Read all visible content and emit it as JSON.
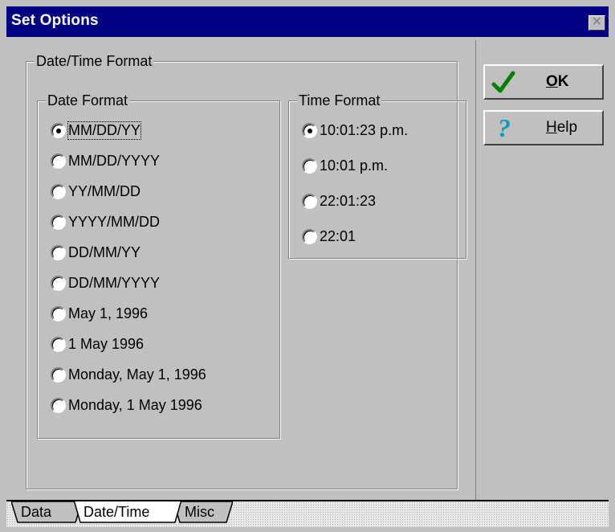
{
  "window": {
    "title": "Set Options",
    "close_glyph": "✕"
  },
  "panel": {
    "group_label": "Date/Time Format",
    "date_format": {
      "label": "Date Format",
      "options": [
        {
          "label": "MM/DD/YY",
          "checked": true
        },
        {
          "label": "MM/DD/YYYY",
          "checked": false
        },
        {
          "label": "YY/MM/DD",
          "checked": false
        },
        {
          "label": "YYYY/MM/DD",
          "checked": false
        },
        {
          "label": "DD/MM/YY",
          "checked": false
        },
        {
          "label": "DD/MM/YYYY",
          "checked": false
        },
        {
          "label": "May 1, 1996",
          "checked": false
        },
        {
          "label": "1 May 1996",
          "checked": false
        },
        {
          "label": "Monday, May 1, 1996",
          "checked": false
        },
        {
          "label": "Monday, 1 May 1996",
          "checked": false
        }
      ]
    },
    "time_format": {
      "label": "Time Format",
      "options": [
        {
          "label": "10:01:23 p.m.",
          "checked": true
        },
        {
          "label": "10:01 p.m.",
          "checked": false
        },
        {
          "label": "22:01:23",
          "checked": false
        },
        {
          "label": "22:01",
          "checked": false
        }
      ]
    }
  },
  "buttons": {
    "ok": {
      "label": "OK",
      "icon": "checkmark-icon",
      "icon_color": "#008000"
    },
    "help": {
      "label": "Help",
      "icon": "question-mark-icon",
      "icon_color": "#00a0c0"
    }
  },
  "tabs": [
    {
      "label": "Data",
      "active": false
    },
    {
      "label": "Date/Time",
      "active": true
    },
    {
      "label": "Misc",
      "active": false
    }
  ]
}
